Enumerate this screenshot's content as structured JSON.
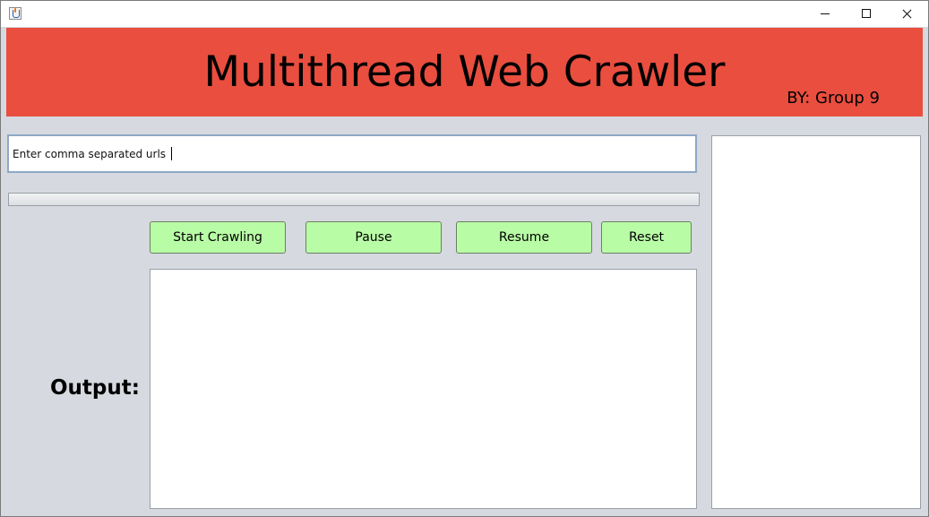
{
  "window": {
    "title": "",
    "icon": "java-cup-icon",
    "controls": [
      "minimize-icon",
      "maximize-icon",
      "close-icon"
    ]
  },
  "header": {
    "title": "Multithread Web Crawler",
    "byline": "BY: Group 9",
    "background_color": "#e94e3f"
  },
  "url_input": {
    "value": "Enter comma separated urls"
  },
  "progress": {
    "value": 0
  },
  "buttons": {
    "start": "Start Crawling",
    "pause": "Pause",
    "resume": "Resume",
    "reset": "Reset",
    "color": "#b9fca6"
  },
  "output": {
    "label": "Output:",
    "text": ""
  },
  "side_panel": {
    "text": ""
  }
}
